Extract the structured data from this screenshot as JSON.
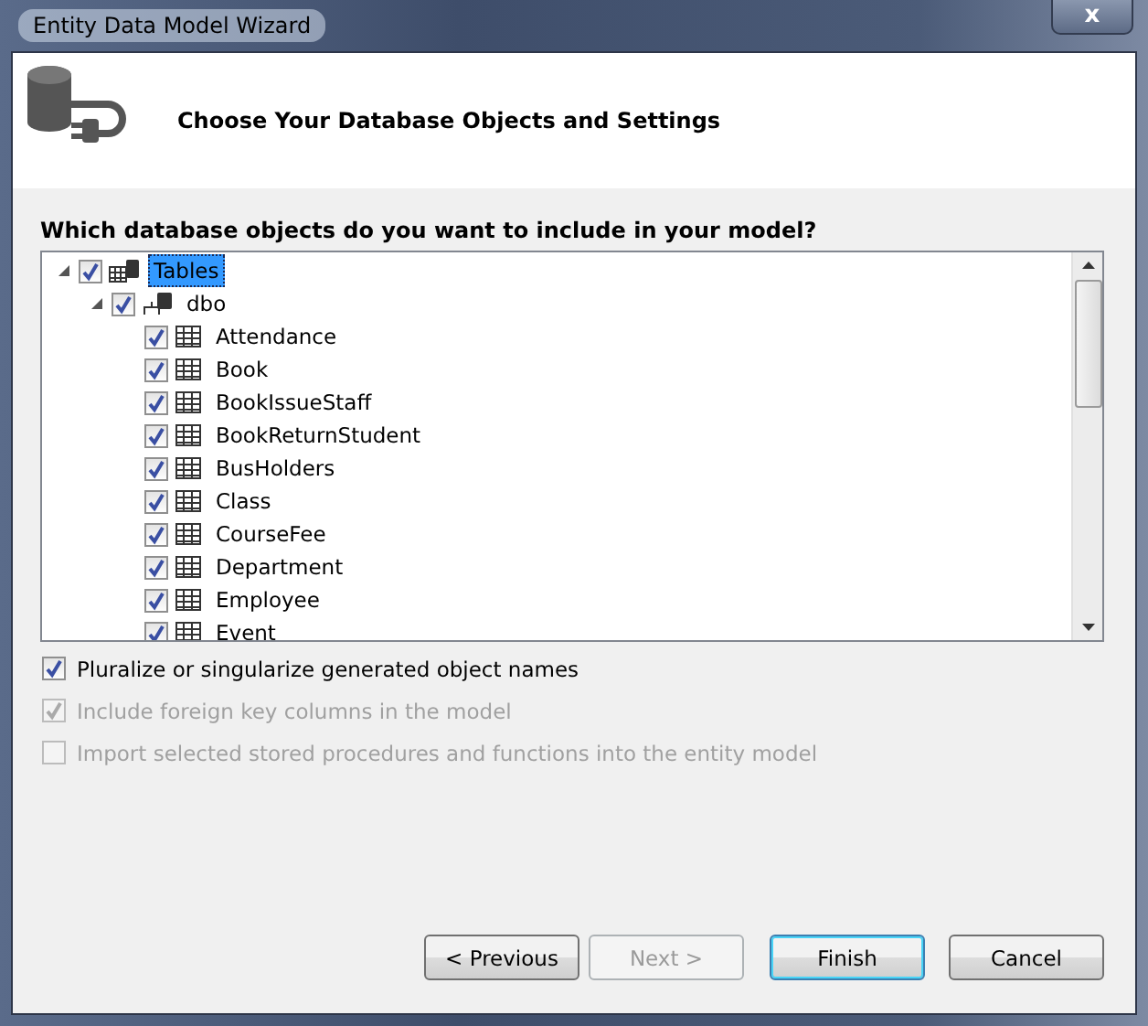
{
  "window": {
    "title": "Entity Data Model Wizard",
    "close_label": "x"
  },
  "header": {
    "title": "Choose Your Database Objects and Settings"
  },
  "prompt": "Which database objects do you want to include in your model?",
  "tree": [
    {
      "label": "Tables",
      "kind": "folder",
      "checked": true,
      "expanded": true,
      "selected": true,
      "children": [
        {
          "label": "dbo",
          "kind": "schema",
          "checked": true,
          "expanded": true,
          "selected": false,
          "children": [
            {
              "label": "Attendance",
              "kind": "table",
              "checked": true,
              "selected": false
            },
            {
              "label": "Book",
              "kind": "table",
              "checked": true,
              "selected": false
            },
            {
              "label": "BookIssueStaff",
              "kind": "table",
              "checked": true,
              "selected": false
            },
            {
              "label": "BookReturnStudent",
              "kind": "table",
              "checked": true,
              "selected": false
            },
            {
              "label": "BusHolders",
              "kind": "table",
              "checked": true,
              "selected": false
            },
            {
              "label": "Class",
              "kind": "table",
              "checked": true,
              "selected": false
            },
            {
              "label": "CourseFee",
              "kind": "table",
              "checked": true,
              "selected": false
            },
            {
              "label": "Department",
              "kind": "table",
              "checked": true,
              "selected": false
            },
            {
              "label": "Employee",
              "kind": "table",
              "checked": true,
              "selected": false
            },
            {
              "label": "Event",
              "kind": "table",
              "checked": true,
              "selected": false
            }
          ]
        }
      ]
    }
  ],
  "options": [
    {
      "label": "Pluralize or singularize generated object names",
      "checked": true,
      "disabled": false
    },
    {
      "label": "Include foreign key columns in the model",
      "checked": true,
      "disabled": true
    },
    {
      "label": "Import selected stored procedures and functions into the entity model",
      "checked": false,
      "disabled": true
    }
  ],
  "buttons": [
    {
      "label": "< Previous",
      "disabled": false,
      "default": false
    },
    {
      "label": "Next >",
      "disabled": true,
      "default": false
    },
    {
      "label": "Finish",
      "disabled": false,
      "default": true
    },
    {
      "label": "Cancel",
      "disabled": false,
      "default": false
    }
  ]
}
